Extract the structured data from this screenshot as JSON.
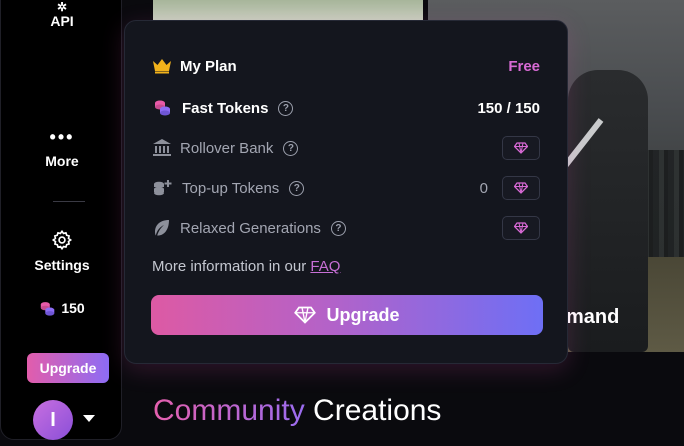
{
  "sidebar": {
    "api_label": "API",
    "more_label": "More",
    "settings_label": "Settings",
    "token_count": "150",
    "upgrade_label": "Upgrade",
    "avatar_initial": "I"
  },
  "background": {
    "image_caption": "mand",
    "community_word1": "Community",
    "community_word2": " Creations"
  },
  "plan_popup": {
    "title": "My Plan",
    "plan_name": "Free",
    "rows": {
      "fast_tokens": {
        "label": "Fast Tokens",
        "value": "150 / 150"
      },
      "rollover_bank": {
        "label": "Rollover Bank"
      },
      "topup_tokens": {
        "label": "Top-up Tokens",
        "value": "0"
      },
      "relaxed": {
        "label": "Relaxed Generations"
      }
    },
    "more_info_text": "More information in our ",
    "faq_link": "FAQ",
    "upgrade_button": "Upgrade"
  },
  "colors": {
    "accent_pink": "#dd5aa4",
    "accent_violet": "#6e6ff5",
    "plan_free": "#d76ad4",
    "crown_gold": "#f2b21b"
  }
}
